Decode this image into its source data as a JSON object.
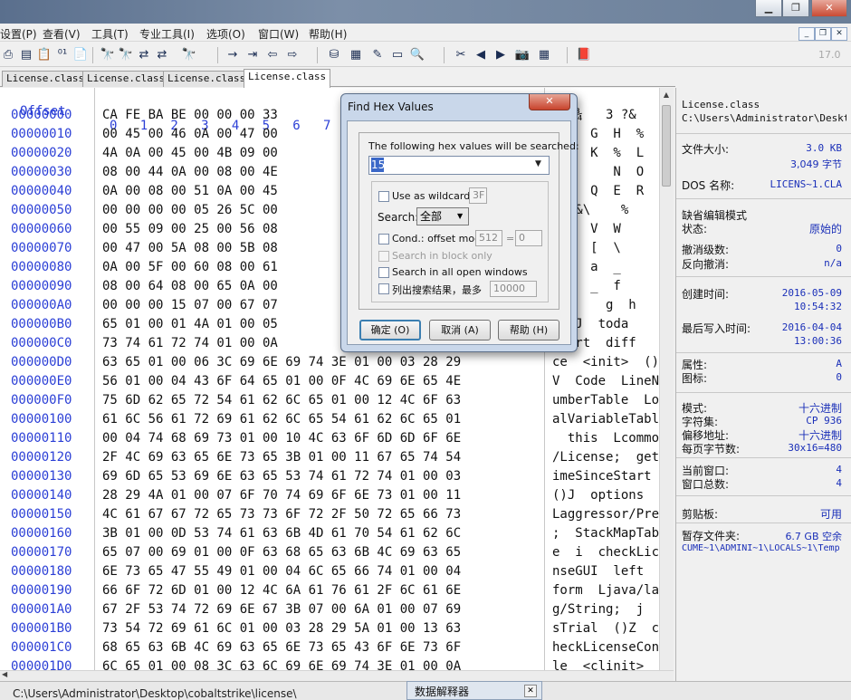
{
  "window": {
    "min": "▁",
    "max": "❐",
    "close": "✕"
  },
  "menu": [
    "设置(P)",
    "查看(V)",
    "工具(T)",
    "专业工具(I)",
    "选项(O)",
    "窗口(W)",
    "帮助(H)"
  ],
  "mdi": [
    "_",
    "❐",
    "✕"
  ],
  "toolbar_badge": "17.0",
  "tabs": [
    "License.class",
    "License.class",
    "License.class",
    "License.class"
  ],
  "hex_header": {
    "offset": "Offset",
    "columns": "0   1   2   3   4   5   6   7"
  },
  "rows": [
    {
      "off": "00000000",
      "hex": "CA FE BA BE 00 00 00 33",
      "txt": "Êþº¾   3 ?&"
    },
    {
      "off": "00000010",
      "hex": "00 45 00 46 0A 00 47 00",
      "txt": "  F  G  H  %"
    },
    {
      "off": "00000020",
      "hex": "4A 0A 00 45 00 4B 09 00",
      "txt": "  E  K  %  L"
    },
    {
      "off": "00000030",
      "hex": "08 00 44 0A 00 08 00 4E",
      "txt": "        N  O"
    },
    {
      "off": "00000040",
      "hex": "0A 00 08 00 51 0A 00 45",
      "txt": "     Q  E  R"
    },
    {
      "off": "00000050",
      "hex": "00 00 00 00 05 26 5C 00",
      "txt": "   &\\    %"
    },
    {
      "off": "00000060",
      "hex": "00 55 09 00 25 00 56 08",
      "txt": "  %  V  W"
    },
    {
      "off": "00000070",
      "hex": "00 47 00 5A 08 00 5B 08",
      "txt": "  Z  [  \\"
    },
    {
      "off": "00000080",
      "hex": "0A 00 5F 00 60 08 00 61",
      "txt": "  `  a  _"
    },
    {
      "off": "00000090",
      "hex": "08 00 64 08 00 65 0A 00",
      "txt": "  e  _  f"
    },
    {
      "off": "000000A0",
      "hex": "00 00 00 15 07 00 67 07",
      "txt": "       g  h"
    },
    {
      "off": "000000B0",
      "hex": "65 01 00 01 4A 01 00 05",
      "txt": "   J  toda"
    },
    {
      "off": "000000C0",
      "hex": "73 74 61 72 74 01 00 0A",
      "txt": "start  diff"
    },
    {
      "off": "000000D0",
      "hex": "63 65 01 00 06 3C 69 6E 69 74 3E 01 00 03 28 29",
      "txt": "ce  <init>  ()"
    },
    {
      "off": "000000E0",
      "hex": "56 01 00 04 43 6F 64 65 01 00 0F 4C 69 6E 65 4E",
      "txt": "V  Code  LineN"
    },
    {
      "off": "000000F0",
      "hex": "75 6D 62 65 72 54 61 62 6C 65 01 00 12 4C 6F 63",
      "txt": "umberTable  Loc"
    },
    {
      "off": "00000100",
      "hex": "61 6C 56 61 72 69 61 62 6C 65 54 61 62 6C 65 01",
      "txt": "alVariableTable"
    },
    {
      "off": "00000110",
      "hex": "00 04 74 68 69 73 01 00 10 4C 63 6F 6D 6D 6F 6E",
      "txt": "  this  Lcommon"
    },
    {
      "off": "00000120",
      "hex": "2F 4C 69 63 65 6E 73 65 3B 01 00 11 67 65 74 54",
      "txt": "/License;  getT"
    },
    {
      "off": "00000130",
      "hex": "69 6D 65 53 69 6E 63 65 53 74 61 72 74 01 00 03",
      "txt": "imeSinceStart"
    },
    {
      "off": "00000140",
      "hex": "28 29 4A 01 00 07 6F 70 74 69 6F 6E 73 01 00 11",
      "txt": "()J  options"
    },
    {
      "off": "00000150",
      "hex": "4C 61 67 67 72 65 73 73 6F 72 2F 50 72 65 66 73",
      "txt": "Laggressor/Prefs"
    },
    {
      "off": "00000160",
      "hex": "3B 01 00 0D 53 74 61 63 6B 4D 61 70 54 61 62 6C",
      "txt": ";  StackMapTabl"
    },
    {
      "off": "00000170",
      "hex": "65 07 00 69 01 00 0F 63 68 65 63 6B 4C 69 63 65",
      "txt": "e  i  checkLice"
    },
    {
      "off": "00000180",
      "hex": "6E 73 65 47 55 49 01 00 04 6C 65 66 74 01 00 04",
      "txt": "nseGUI  left"
    },
    {
      "off": "00000190",
      "hex": "66 6F 72 6D 01 00 12 4C 6A 61 76 61 2F 6C 61 6E",
      "txt": "form  Ljava/lan"
    },
    {
      "off": "000001A0",
      "hex": "67 2F 53 74 72 69 6E 67 3B 07 00 6A 01 00 07 69",
      "txt": "g/String;  j  i"
    },
    {
      "off": "000001B0",
      "hex": "73 54 72 69 61 6C 01 00 03 28 29 5A 01 00 13 63",
      "txt": "sTrial  ()Z  c"
    },
    {
      "off": "000001C0",
      "hex": "68 65 63 6B 4C 69 63 65 6E 73 65 43 6F 6E 73 6F",
      "txt": "heckLicenseCons"
    },
    {
      "off": "000001D0",
      "hex": "6C 65 01 00 08 3C 63 6C 69 6E 69 74 3E 01 00 0A",
      "txt": "le  <clinit>"
    }
  ],
  "info": {
    "filename": "License.class",
    "path": "C:\\Users\\Administrator\\Desktop",
    "filesize_label": "文件大小:",
    "filesize_kb": "3.0 KB",
    "filesize_bytes": "3,049 字节",
    "dos_label": "DOS 名称:",
    "dos_value": "LICENS~1.CLA",
    "mode_label": "缺省编辑模式",
    "state_label": "状态:",
    "state_value": "原始的",
    "undo_level_label": "撤消级数:",
    "undo_level_value": "0",
    "reverse_undo_label": "反向撤消:",
    "reverse_undo_value": "n/a",
    "created_label": "创建时间:",
    "created_date": "2016-05-09",
    "created_time": "10:54:32",
    "modified_label": "最后写入时间:",
    "modified_date": "2016-04-04",
    "modified_time": "13:00:36",
    "attr_label": "属性:",
    "attr_value": "A",
    "icon_label": "图标:",
    "icon_value": "0",
    "mode2_label": "模式:",
    "mode2_value": "十六进制",
    "charset_label": "字符集:",
    "charset_value": "CP 936",
    "offset_label": "偏移地址:",
    "offset_value": "十六进制",
    "bpp_label": "每页字节数:",
    "bpp_value": "30x16=480",
    "curwin_label": "当前窗口:",
    "curwin_value": "4",
    "totwin_label": "窗口总数:",
    "totwin_value": "4",
    "clipboard_label": "剪贴板:",
    "clipboard_value": "可用",
    "temp_label": "暂存文件夹:",
    "temp_value": "6.7 GB 空余",
    "temp_path": "CUME~1\\ADMINI~1\\LOCALS~1\\Temp"
  },
  "status": {
    "path": "C:\\Users\\Administrator\\Desktop\\cobaltstrike\\license\\",
    "data_interpreter": "数据解释器",
    "close": "✕"
  },
  "dialog": {
    "title": "Find Hex Values",
    "close": "✕",
    "label": "The following hex values will be searched:",
    "value": "15",
    "wildcard_label": "Use as wildcard:",
    "wildcard_value": "3F",
    "search_label": "Search:",
    "search_value": "全部",
    "cond_label": "Cond.: offset mod",
    "cond_mod": "512",
    "cond_eq": "=",
    "cond_val": "0",
    "block_only": "Search in block only",
    "all_windows": "Search in all open windows",
    "list_results": "列出搜索结果，最多",
    "list_max": "10000",
    "ok": "确定 (O)",
    "cancel": "取消 (A)",
    "help": "帮助 (H)"
  }
}
